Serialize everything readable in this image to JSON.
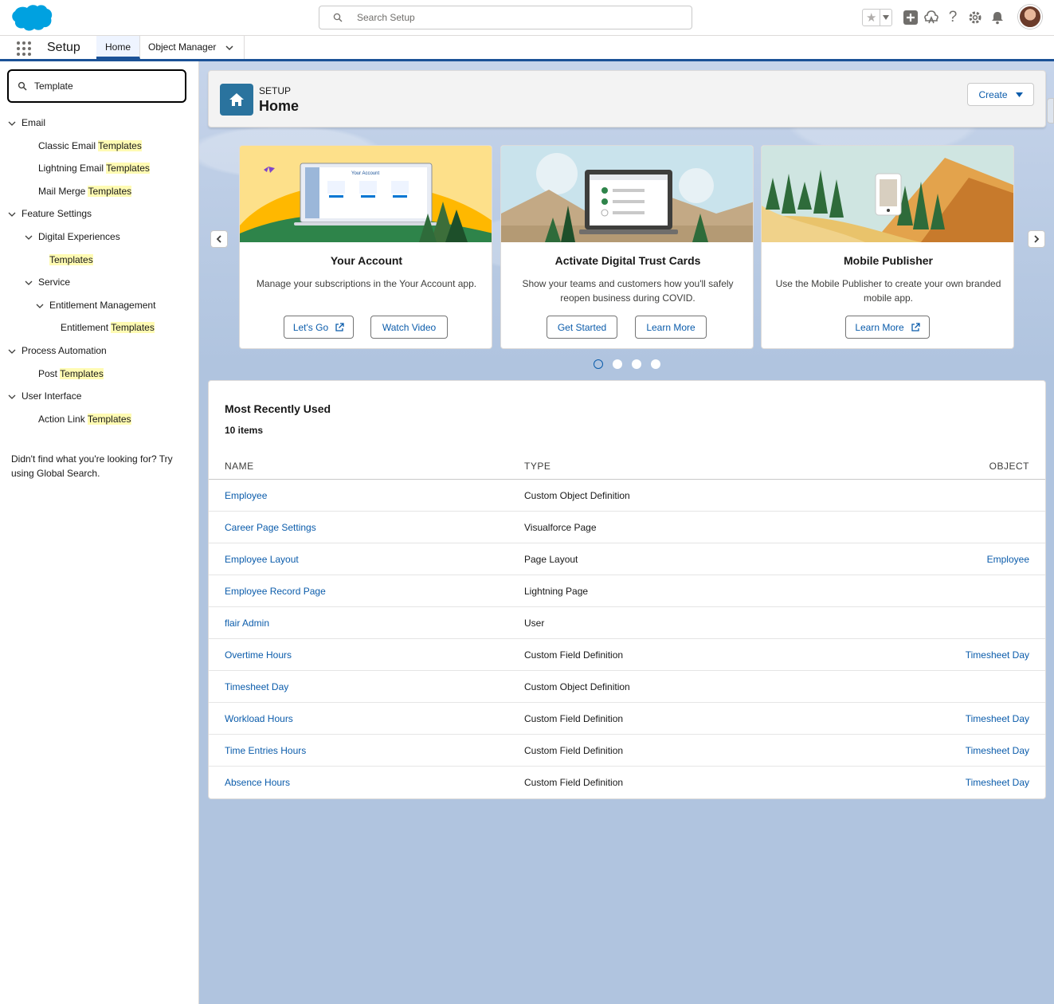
{
  "header": {
    "search_placeholder": "Search Setup"
  },
  "context_bar": {
    "app_name": "Setup",
    "tabs": [
      {
        "label": "Home",
        "active": true
      },
      {
        "label": "Object Manager",
        "active": false
      }
    ]
  },
  "sidebar": {
    "quick_find_value": "Template",
    "tree": [
      {
        "level": 0,
        "label": "Email",
        "highlight": "",
        "expanded": true
      },
      {
        "level": 1,
        "label": "Classic Email ",
        "highlight": "Templates",
        "expanded": null
      },
      {
        "level": 1,
        "label": "Lightning Email ",
        "highlight": "Templates",
        "expanded": null
      },
      {
        "level": 1,
        "label": "Mail Merge ",
        "highlight": "Templates",
        "expanded": null
      },
      {
        "level": 0,
        "label": "Feature Settings",
        "highlight": "",
        "expanded": true
      },
      {
        "level": 1,
        "label": "Digital Experiences",
        "highlight": "",
        "expanded": true
      },
      {
        "level": 2,
        "label": "",
        "highlight": "Templates",
        "expanded": null
      },
      {
        "level": 1,
        "label": "Service",
        "highlight": "",
        "expanded": true
      },
      {
        "level": 2,
        "label": "Entitlement Management",
        "highlight": "",
        "expanded": true
      },
      {
        "level": 3,
        "label": "Entitlement ",
        "highlight": "Templates",
        "expanded": null
      },
      {
        "level": 0,
        "label": "Process Automation",
        "highlight": "",
        "expanded": true
      },
      {
        "level": 1,
        "label": "Post ",
        "highlight": "Templates",
        "expanded": null
      },
      {
        "level": 0,
        "label": "User Interface",
        "highlight": "",
        "expanded": true
      },
      {
        "level": 1,
        "label": "Action Link ",
        "highlight": "Templates",
        "expanded": null
      }
    ],
    "not_found_text": "Didn't find what you're looking for? Try using Global Search."
  },
  "page_header": {
    "eyebrow": "SETUP",
    "title": "Home",
    "create_label": "Create"
  },
  "carousel": {
    "cards": [
      {
        "title": "Your Account",
        "description": "Manage your subscriptions in the Your Account app.",
        "buttons": [
          "Let's Go",
          "Watch Video"
        ],
        "illustration_text": "Your Account"
      },
      {
        "title": "Activate Digital Trust Cards",
        "description": "Show your teams and customers how you'll safely reopen business during COVID.",
        "buttons": [
          "Get Started",
          "Learn More"
        ]
      },
      {
        "title": "Mobile Publisher",
        "description": "Use the Mobile Publisher to create your own branded mobile app.",
        "buttons": [
          "Learn More"
        ]
      }
    ],
    "page_count": 4,
    "active_page": 1
  },
  "mru": {
    "title": "Most Recently Used",
    "count_text": "10 items",
    "columns": [
      "NAME",
      "TYPE",
      "OBJECT"
    ],
    "rows": [
      {
        "name": "Employee",
        "type": "Custom Object Definition",
        "object": ""
      },
      {
        "name": "Career Page Settings",
        "type": "Visualforce Page",
        "object": ""
      },
      {
        "name": "Employee Layout",
        "type": "Page Layout",
        "object": "Employee"
      },
      {
        "name": "Employee Record Page",
        "type": "Lightning Page",
        "object": ""
      },
      {
        "name": "flair Admin",
        "type": "User",
        "object": ""
      },
      {
        "name": "Overtime Hours",
        "type": "Custom Field Definition",
        "object": "Timesheet Day"
      },
      {
        "name": "Timesheet Day",
        "type": "Custom Object Definition",
        "object": ""
      },
      {
        "name": "Workload Hours",
        "type": "Custom Field Definition",
        "object": "Timesheet Day"
      },
      {
        "name": "Time Entries Hours",
        "type": "Custom Field Definition",
        "object": "Timesheet Day"
      },
      {
        "name": "Absence Hours",
        "type": "Custom Field Definition",
        "object": "Timesheet Day"
      }
    ]
  }
}
